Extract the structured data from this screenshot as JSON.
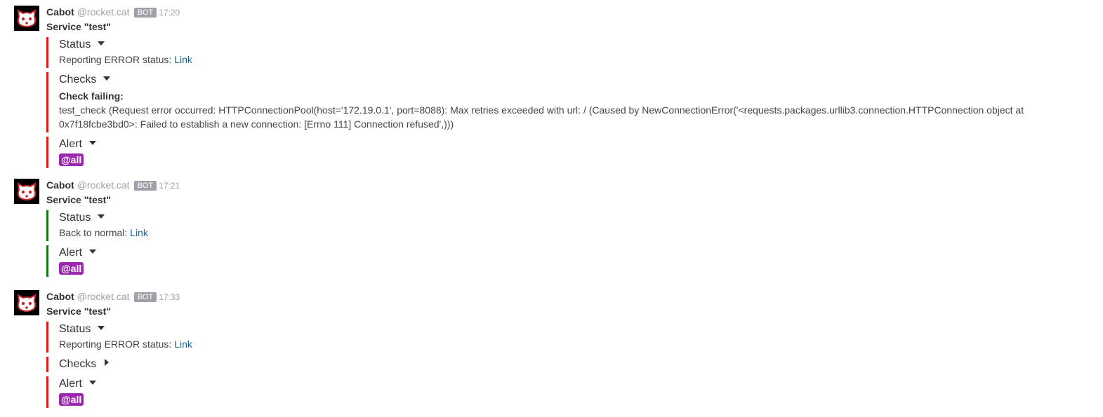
{
  "messages": [
    {
      "name": "Cabot",
      "username": "@rocket.cat",
      "badge": "BOT",
      "time": "17:20",
      "text": "Service \"test\"",
      "attachments": [
        {
          "title": "Status",
          "status_text": "Reporting ERROR status:",
          "link_text": "Link",
          "color": "#e01b1b"
        },
        {
          "title": "Checks",
          "check_title": "Check failing:",
          "check_text": "test_check (Request error occurred: HTTPConnectionPool(host='172.19.0.1', port=8088): Max retries exceeded with url: / (Caused by NewConnectionError('<requests.packages.urllib3.connection.HTTPConnection object at 0x7f18fcbe3bd0>: Failed to establish a new connection: [Errno 111] Connection refused',)))",
          "color": "#e01b1b"
        },
        {
          "title": "Alert",
          "mention": "@all",
          "color": "#e01b1b"
        }
      ]
    },
    {
      "name": "Cabot",
      "username": "@rocket.cat",
      "badge": "BOT",
      "time": "17:21",
      "text": "Service \"test\"",
      "attachments": [
        {
          "title": "Status",
          "status_text": "Back to normal:",
          "link_text": "Link",
          "color": "#157a15"
        },
        {
          "title": "Alert",
          "mention": "@all",
          "color": "#157a15"
        }
      ]
    },
    {
      "name": "Cabot",
      "username": "@rocket.cat",
      "badge": "BOT",
      "time": "17:33",
      "text": "Service \"test\"",
      "attachments": [
        {
          "title": "Status",
          "status_text": "Reporting ERROR status:",
          "link_text": "Link",
          "color": "#e01b1b"
        },
        {
          "title": "Checks",
          "collapsed": true,
          "color": "#e01b1b"
        },
        {
          "title": "Alert",
          "mention": "@all",
          "color": "#e01b1b"
        }
      ]
    }
  ],
  "avatar_icon": "cat-face-icon",
  "mention_color": "#9c27b0"
}
